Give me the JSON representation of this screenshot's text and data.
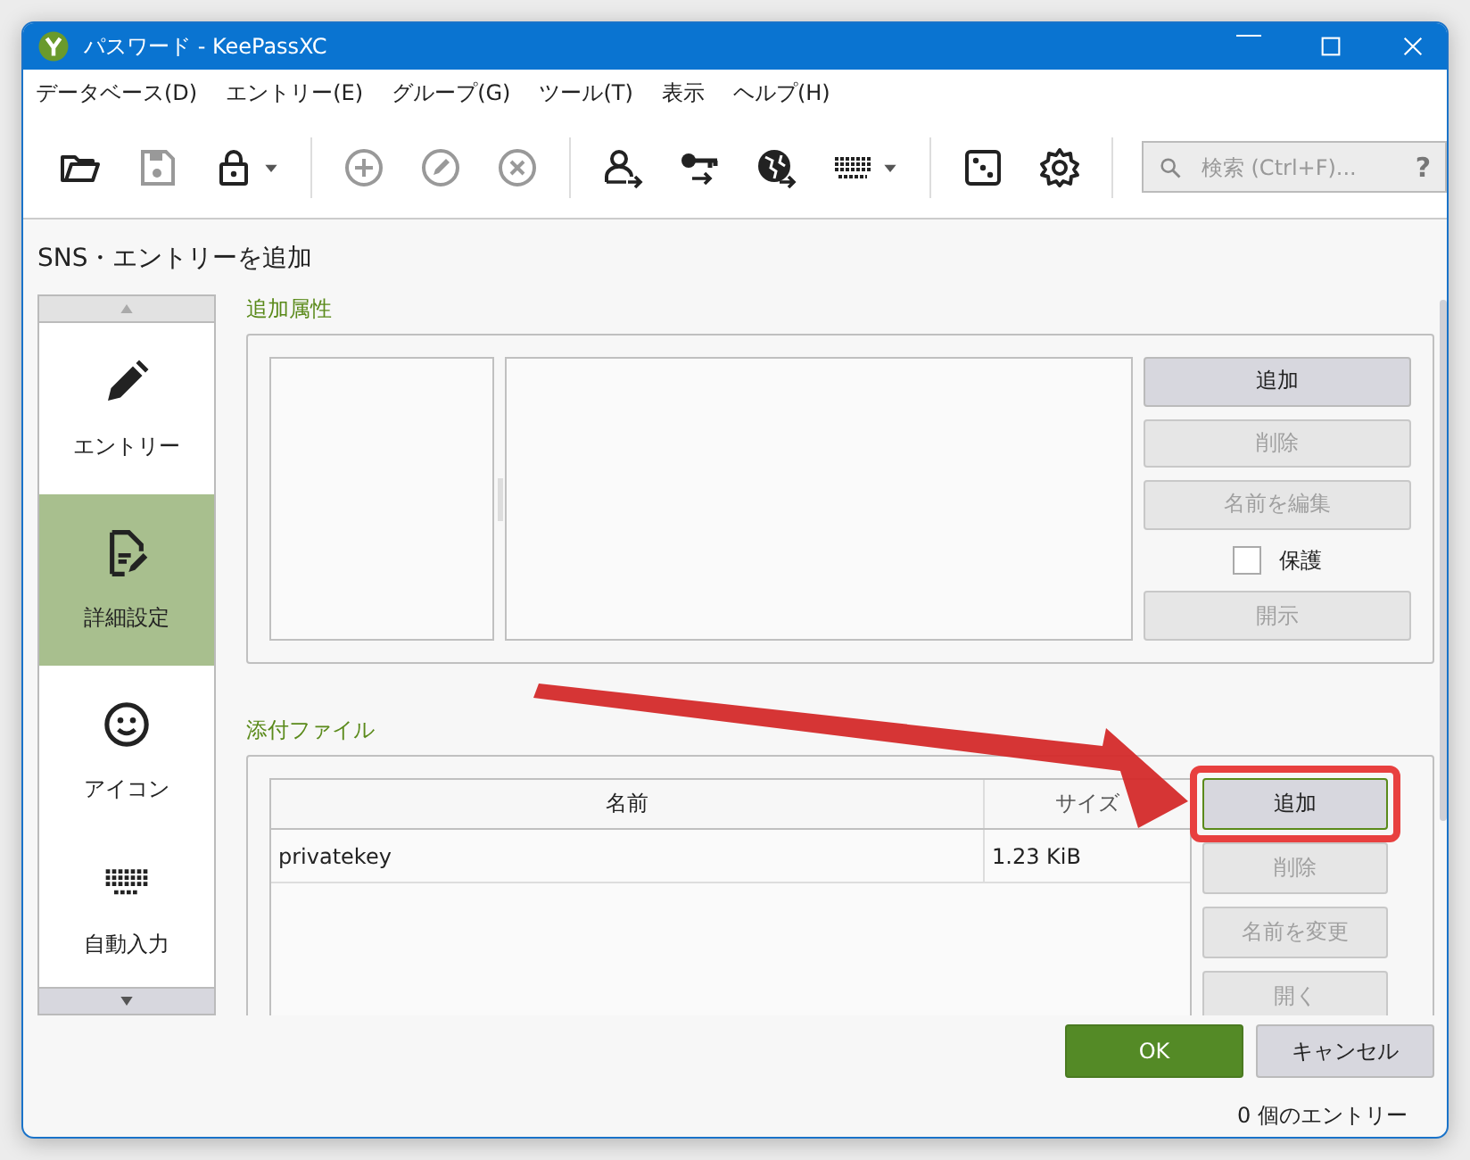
{
  "window": {
    "title": "パスワード - KeePassXC"
  },
  "menu": [
    "データベース(D)",
    "エントリー(E)",
    "グループ(G)",
    "ツール(T)",
    "表示",
    "ヘルプ(H)"
  ],
  "toolbar": [
    {
      "items": [
        {
          "disabled": false,
          "dropdown": false
        },
        {
          "disabled": true,
          "dropdown": false
        },
        {
          "disabled": false,
          "dropdown": true
        }
      ]
    },
    {
      "items": [
        {
          "disabled": true,
          "dropdown": false
        },
        {
          "disabled": true,
          "dropdown": false
        },
        {
          "disabled": true,
          "dropdown": false
        }
      ]
    },
    {
      "items": [
        {
          "disabled": false,
          "dropdown": false
        },
        {
          "disabled": false,
          "dropdown": false
        },
        {
          "disabled": false,
          "dropdown": false
        },
        {
          "disabled": false,
          "dropdown": true
        }
      ]
    },
    {
      "items": [
        {
          "disabled": false,
          "dropdown": false
        },
        {
          "disabled": false,
          "dropdown": false
        }
      ]
    }
  ],
  "search": {
    "placeholder": "検索 (Ctrl+F)...",
    "help": "?"
  },
  "page_title": "SNS・エントリーを追加",
  "sidebar": {
    "items": [
      {
        "label": "エントリー",
        "selected": false
      },
      {
        "label": "詳細設定",
        "selected": true
      },
      {
        "label": "アイコン",
        "selected": false
      },
      {
        "label": "自動入力",
        "selected": false
      }
    ]
  },
  "attributes": {
    "title": "追加属性",
    "controls": [
      {
        "kind": "button",
        "label": "追加",
        "disabled": false
      },
      {
        "kind": "button",
        "label": "削除",
        "disabled": true
      },
      {
        "kind": "button",
        "label": "名前を編集",
        "disabled": true
      },
      {
        "kind": "checkbox",
        "label": "保護",
        "checked": false
      },
      {
        "kind": "button",
        "label": "開示",
        "disabled": true
      }
    ]
  },
  "attachments": {
    "title": "添付ファイル",
    "columns": [
      "名前",
      "サイズ"
    ],
    "rows": [
      [
        "privatekey",
        "1.23 KiB"
      ]
    ],
    "buttons": [
      {
        "label": "追加",
        "disabled": false,
        "highlighted": true
      },
      {
        "label": "削除",
        "disabled": true,
        "highlighted": false
      },
      {
        "label": "名前を変更",
        "disabled": true,
        "highlighted": false
      },
      {
        "label": "開く",
        "disabled": true,
        "highlighted": false
      }
    ]
  },
  "dialog_buttons": [
    {
      "label": "OK",
      "kind": "primary"
    },
    {
      "label": "キャンセル",
      "kind": "normal"
    }
  ],
  "status_bar": "0 個のエントリー"
}
